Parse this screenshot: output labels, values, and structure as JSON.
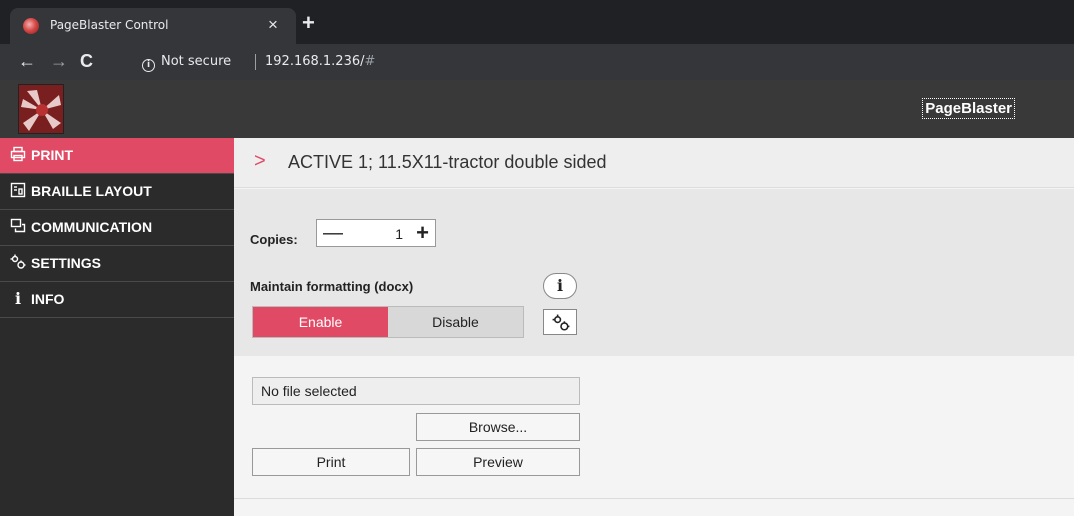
{
  "browser": {
    "tab_title": "PageBlaster Control",
    "close_glyph": "×",
    "new_tab_glyph": "+",
    "security_label": "Not secure",
    "url_host": "192.168.1.236/",
    "url_hash": "#"
  },
  "app": {
    "brand": "PageBlaster",
    "accent_color": "#e04a64"
  },
  "sidebar": {
    "items": [
      {
        "label": "PRINT",
        "icon": "printer-icon",
        "active": true
      },
      {
        "label": "BRAILLE LAYOUT",
        "icon": "layout-icon",
        "active": false
      },
      {
        "label": "COMMUNICATION",
        "icon": "communication-icon",
        "active": false
      },
      {
        "label": "SETTINGS",
        "icon": "gears-icon",
        "active": false
      },
      {
        "label": "INFO",
        "icon": "info-icon",
        "active": false
      }
    ]
  },
  "main": {
    "active_title": "ACTIVE 1; 11.5X11-tractor double sided",
    "copies_label": "Copies:",
    "copies_minus": "—",
    "copies_value": "1",
    "copies_plus": "+",
    "maintain_formatting_label": "Maintain formatting (docx)",
    "info_glyph": "i",
    "enable_label": "Enable",
    "disable_label": "Disable",
    "formatting_selected": "Enable",
    "file_status": "No file selected",
    "browse_label": "Browse...",
    "print_label": "Print",
    "preview_label": "Preview"
  }
}
